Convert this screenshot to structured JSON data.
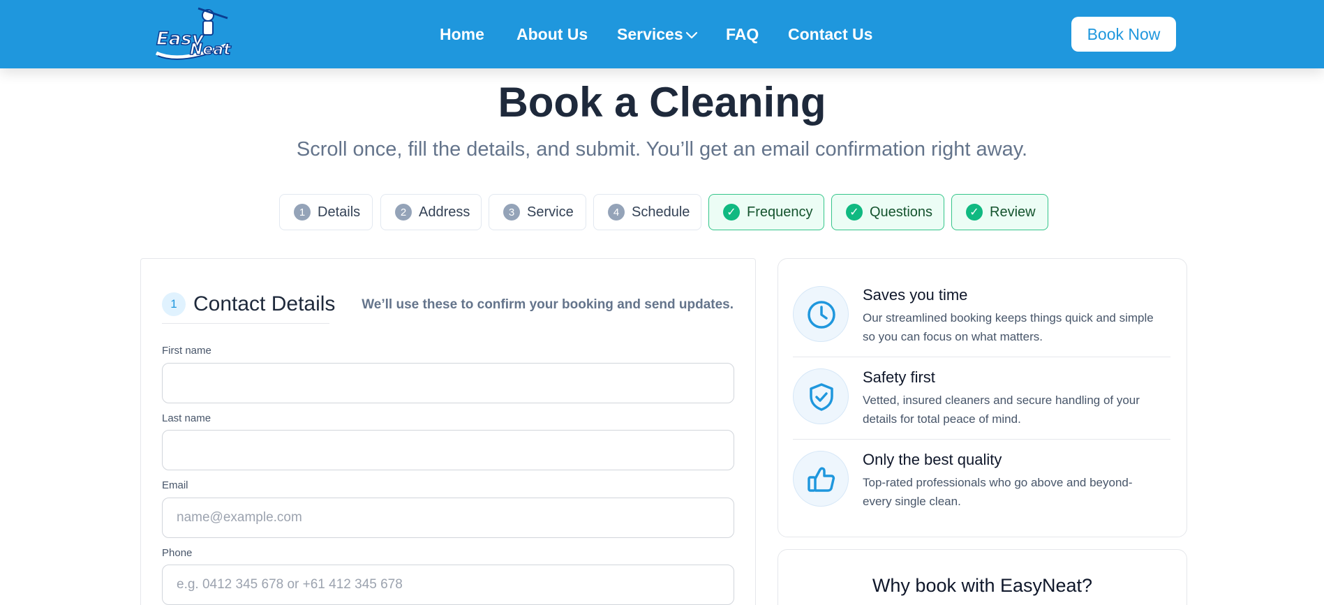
{
  "header": {
    "logo_text": "Easy Neat",
    "nav": {
      "home": "Home",
      "about": "About Us",
      "services": "Services",
      "faq": "FAQ",
      "contact": "Contact Us"
    },
    "book_now": "Book Now"
  },
  "hero": {
    "title": "Book a Cleaning",
    "subtitle": "Scroll once, fill the details, and submit. You’ll get an email confirmation right away."
  },
  "steps": [
    {
      "num": "1",
      "label": "Details",
      "status": "pending"
    },
    {
      "num": "2",
      "label": "Address",
      "status": "pending"
    },
    {
      "num": "3",
      "label": "Service",
      "status": "pending"
    },
    {
      "num": "4",
      "label": "Schedule",
      "status": "pending"
    },
    {
      "num": "✓",
      "label": "Frequency",
      "status": "done"
    },
    {
      "num": "✓",
      "label": "Questions",
      "status": "done"
    },
    {
      "num": "✓",
      "label": "Review",
      "status": "done"
    }
  ],
  "contact_section": {
    "number": "1",
    "title": "Contact Details",
    "note": "We’ll use these to confirm your booking and send updates.",
    "fields": {
      "first_name": {
        "label": "First name",
        "value": "",
        "placeholder": ""
      },
      "last_name": {
        "label": "Last name",
        "value": "",
        "placeholder": ""
      },
      "email": {
        "label": "Email",
        "value": "",
        "placeholder": "name@example.com"
      },
      "phone": {
        "label": "Phone",
        "value": "",
        "placeholder": "e.g. 0412 345 678 or +61 412 345 678"
      }
    }
  },
  "features": [
    {
      "icon": "clock-icon",
      "title": "Saves you time",
      "desc": "Our streamlined booking keeps things quick and simple so you can focus on what matters."
    },
    {
      "icon": "shield-check-icon",
      "title": "Safety first",
      "desc": "Vetted, insured cleaners and secure handling of your details for total peace of mind."
    },
    {
      "icon": "thumbs-up-icon",
      "title": "Only the best quality",
      "desc": "Top-rated professionals who go above and beyond- every single clean."
    }
  ],
  "why": {
    "title": "Why book with EasyNeat?"
  },
  "colors": {
    "brand_blue": "#1f97dd",
    "done_green": "#10b981",
    "pending_gray": "#94a3b8"
  }
}
